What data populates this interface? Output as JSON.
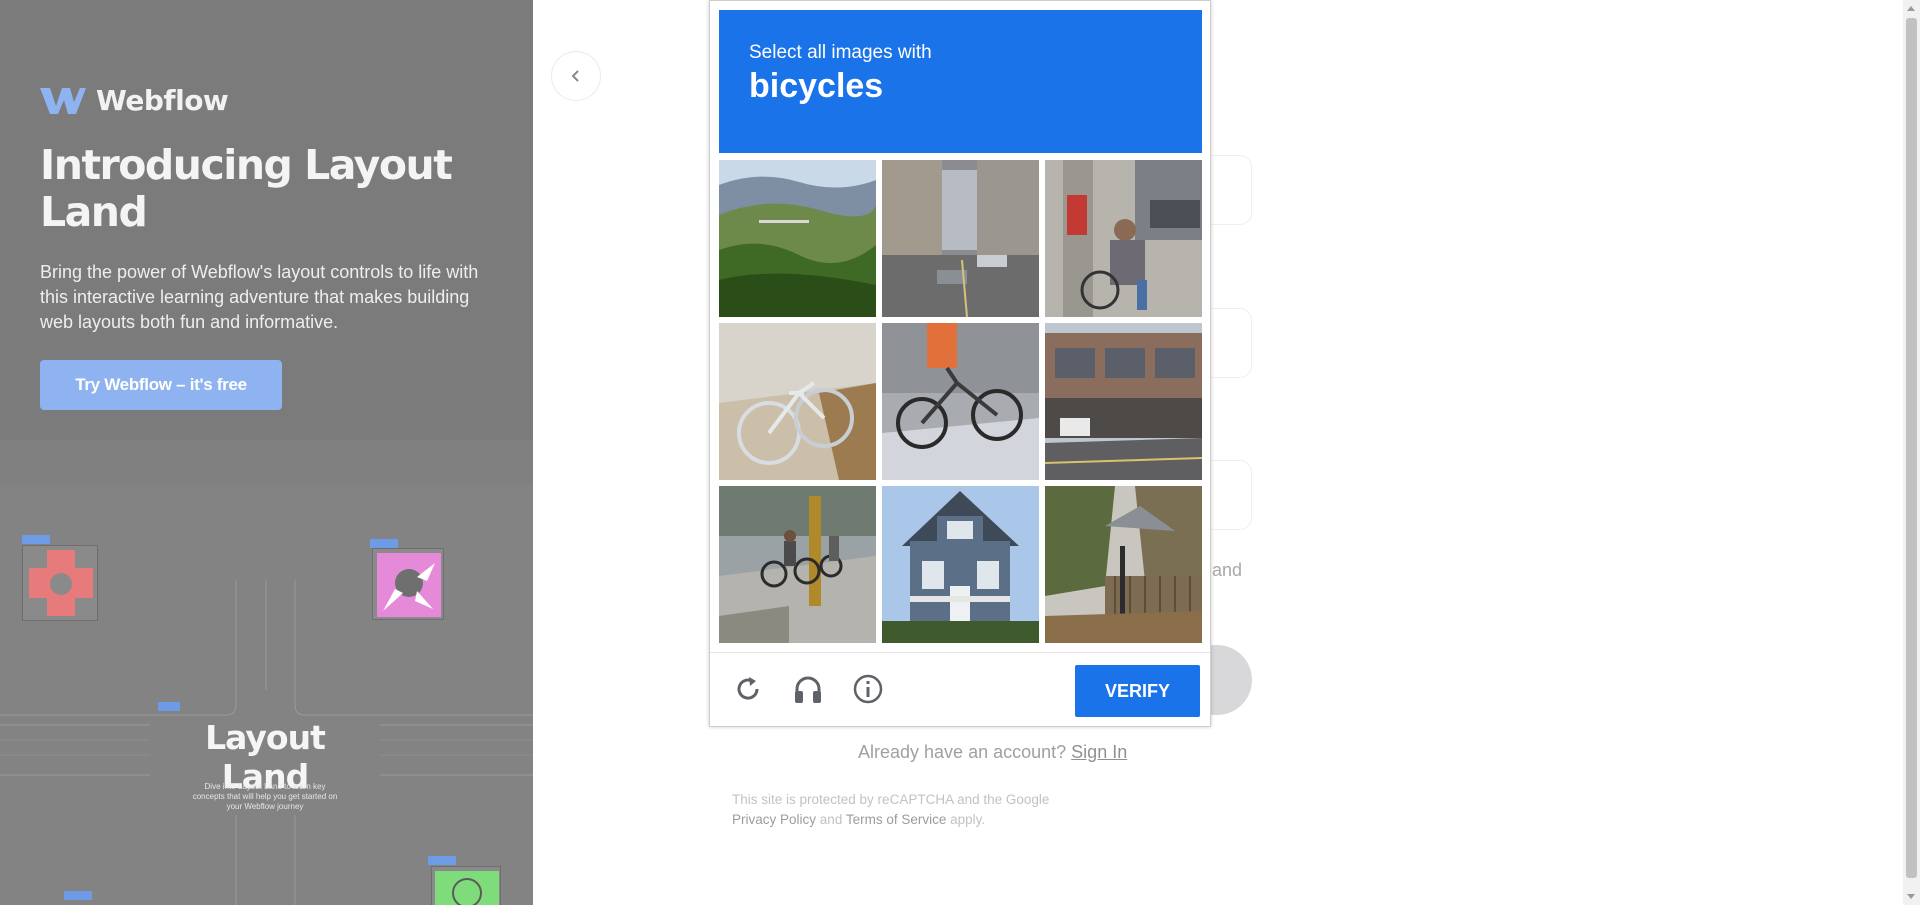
{
  "promo": {
    "logo_text": "Webflow",
    "title": "Introducing Layout Land",
    "description": "Bring the power of Webflow's layout controls to life with this interactive learning adventure that makes building web layouts both fun and informative.",
    "cta_label": "Try Webflow – it's free",
    "illustration": {
      "title": "Layout Land",
      "description": "Dive into Layout Land to learn key concepts that will help you get started on your Webflow journey"
    }
  },
  "form": {
    "back_icon": "chevron-left-icon",
    "partial_text": "and",
    "signin_prompt": "Already have an account?",
    "signin_link": "Sign In",
    "recaptcha_note_line1": "This site is protected by reCAPTCHA and the Google",
    "privacy_link": "Privacy Policy",
    "and_word": "and",
    "terms_link": "Terms of Service",
    "apply_word": "apply."
  },
  "captcha": {
    "instruction": "Select all images with",
    "target": "bicycles",
    "tiles": [
      {
        "scene": "hillside-forest"
      },
      {
        "scene": "city-street-cars"
      },
      {
        "scene": "person-bicycle-pole"
      },
      {
        "scene": "bicycle-on-sidewalk"
      },
      {
        "scene": "bicycle-with-sign"
      },
      {
        "scene": "storefront-street"
      },
      {
        "scene": "cyclists-on-road"
      },
      {
        "scene": "blue-house"
      },
      {
        "scene": "trees-and-fence"
      }
    ],
    "reload_icon": "reload-icon",
    "audio_icon": "headphones-icon",
    "info_icon": "info-icon",
    "verify_label": "VERIFY",
    "accent_color": "#1a73e8"
  }
}
